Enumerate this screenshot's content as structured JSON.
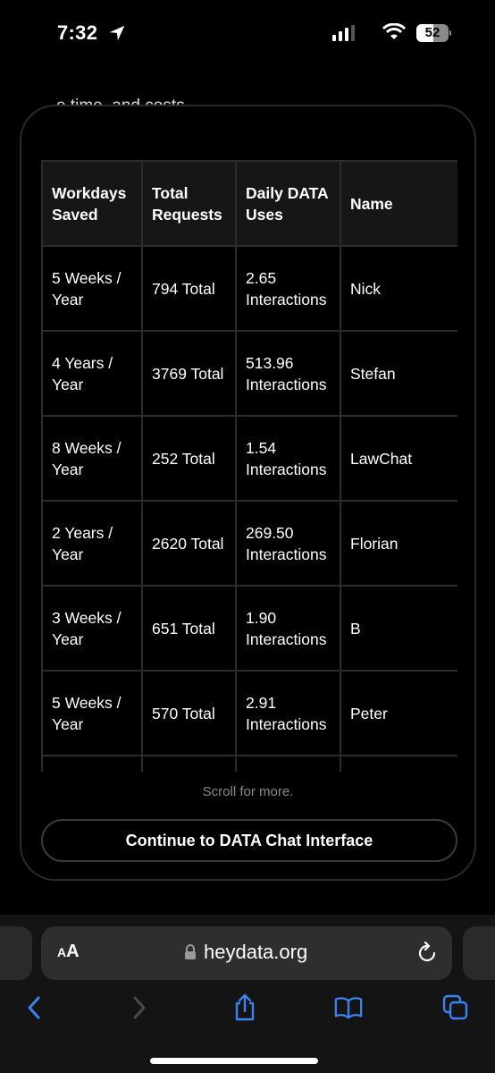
{
  "status_bar": {
    "time": "7:32",
    "battery_level": "52",
    "battery_fraction": 0.52
  },
  "page": {
    "peek_text": "…e time, and costs",
    "table": {
      "columns": [
        "Workdays Saved",
        "Total Requests",
        "Daily DATA Uses",
        "Name"
      ],
      "rows": [
        [
          "5 Weeks / Year",
          "794 Total",
          "2.65 Interactions",
          "Nick"
        ],
        [
          "4 Years / Year",
          "3769 Total",
          "513.96 Interactions",
          "Stefan"
        ],
        [
          "8 Weeks / Year",
          "252 Total",
          "1.54 Interactions",
          "LawChat"
        ],
        [
          "2 Years / Year",
          "2620 Total",
          "269.50 Interactions",
          "Florian"
        ],
        [
          "3 Weeks / Year",
          "651 Total",
          "1.90 Interactions",
          "B"
        ],
        [
          "5 Weeks / Year",
          "570 Total",
          "2.91 Interactions",
          "Peter"
        ],
        [
          "",
          "",
          "",
          ""
        ]
      ]
    },
    "scroll_note": "Scroll for more.",
    "continue_label": "Continue to DATA Chat Interface"
  },
  "browser": {
    "text_size_label_small": "A",
    "text_size_label_large": "A",
    "url": "heydata.org",
    "accent_color": "#3b82f6"
  }
}
